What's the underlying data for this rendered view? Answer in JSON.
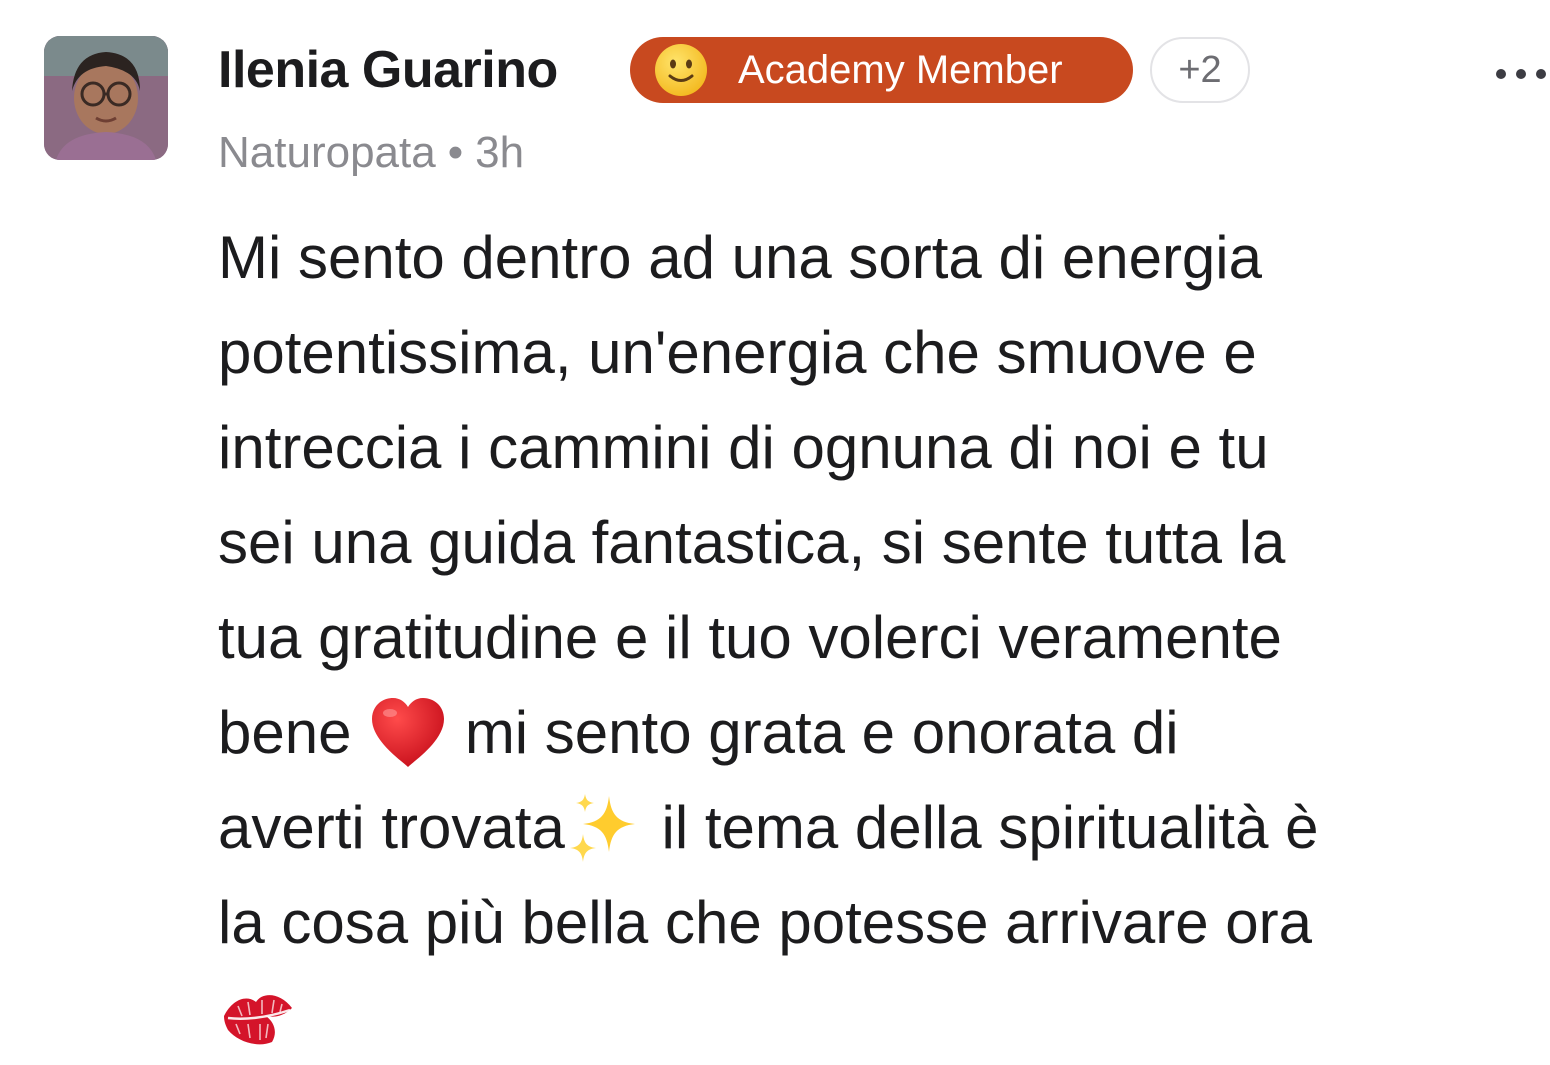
{
  "author": {
    "name": "Ilenia Guarino",
    "avatar_icon": "profile-photo-avatar",
    "role": "Naturopata",
    "separator": "•",
    "time_ago": "3h"
  },
  "badge": {
    "emoji_icon": "slightly-smiling-face-icon",
    "label": "Academy Member",
    "color": "#c8491f"
  },
  "extra_badges": "+2",
  "menu_icon": "more-horizontal-icon",
  "post": {
    "lines": [
      {
        "text": "Mi sento dentro ad una sorta di energia"
      },
      {
        "text": "potentissima, un'energia che smuove e"
      },
      {
        "text": "intreccia i cammini di ognuna di noi e tu"
      },
      {
        "text": "sei una guida fantastica, si sente tutta la"
      },
      {
        "text": "tua gratitudine e il tuo volerci veramente"
      },
      {
        "before": "bene ",
        "emoji": "red-heart-icon",
        "after": " mi sento grata e onorata di"
      },
      {
        "before": "averti trovata",
        "emoji": "sparkles-icon",
        "after": " il tema della spiritualità è"
      },
      {
        "text": "la cosa più bella che potesse arrivare ora"
      },
      {
        "before": "",
        "emoji": "kiss-mark-icon",
        "after": ""
      }
    ]
  }
}
